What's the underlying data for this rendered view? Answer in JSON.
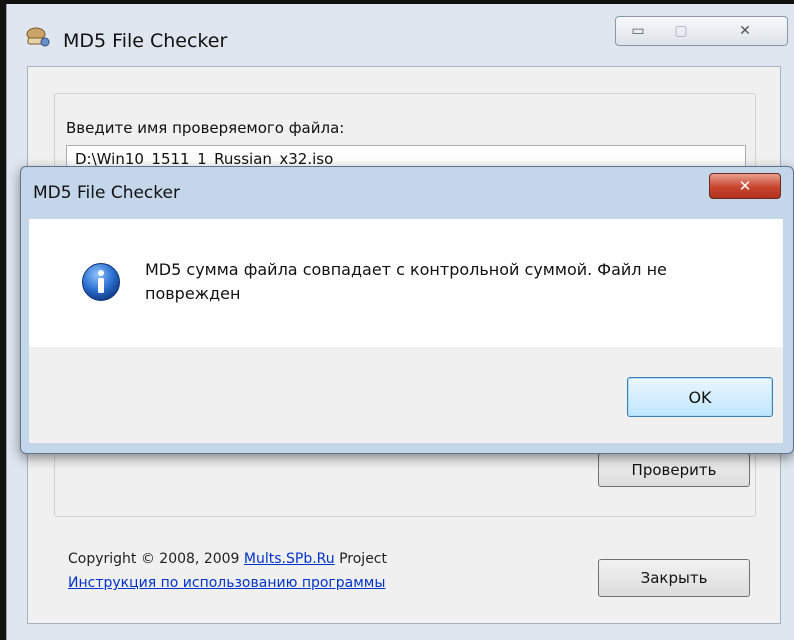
{
  "main_window": {
    "title": "MD5 File Checker",
    "controls": {
      "minimize": "▭",
      "maximize": "▢",
      "close": "✕"
    },
    "file_label": "Введите имя проверяемого файла:",
    "file_value": "D:\\Win10_1511_1_Russian_x32.iso",
    "check_button": "Проверить",
    "copyright_prefix": "Copyright © 2008, 2009 ",
    "copyright_link": "Mults.SPb.Ru",
    "copyright_suffix": " Project",
    "instructions_link": "Инструкция по использованию программы",
    "close_button": "Закрыть"
  },
  "message_box": {
    "title": "MD5 File Checker",
    "close": "✕",
    "icon": "info-icon",
    "message": "MD5 сумма файла совпадает с контрольной суммой. Файл не поврежден",
    "ok_button": "OK"
  },
  "colors": {
    "window_frame": "#dfe6ef",
    "dialog_frame": "#c4d6ea",
    "link": "#0033cc",
    "close_red": "#c8452e",
    "info_blue": "#1f5fbf"
  }
}
